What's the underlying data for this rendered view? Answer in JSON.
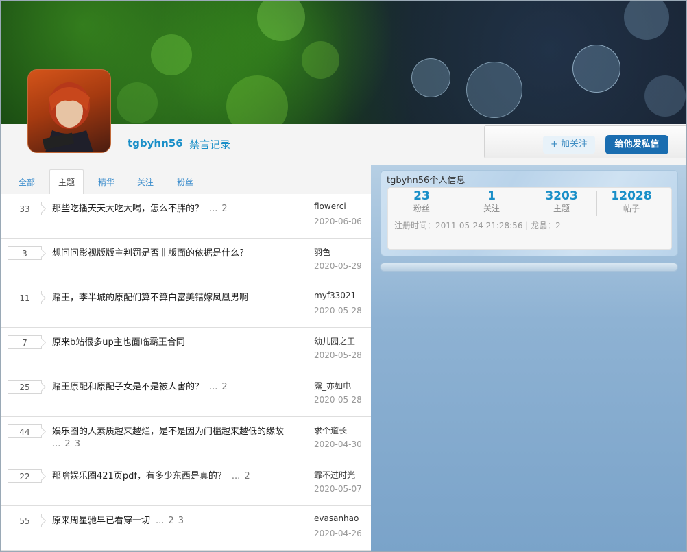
{
  "profile": {
    "username": "tgbyhn56",
    "ban_record": "禁言记录",
    "avatar_icon": "death-note-avatar-icon"
  },
  "actions": {
    "follow": "+ 加关注",
    "message": "给他发私信"
  },
  "tabs": [
    {
      "label": "全部",
      "active": false
    },
    {
      "label": "主题",
      "active": true
    },
    {
      "label": "精华",
      "active": false
    },
    {
      "label": "关注",
      "active": false
    },
    {
      "label": "粉丝",
      "active": false
    }
  ],
  "threads": [
    {
      "count": "33",
      "title": "那些吃播天天大吃大喝，怎么不胖的？",
      "pages": [
        "...",
        "2"
      ],
      "author": "flowerci",
      "date": "2020-06-06"
    },
    {
      "count": "3",
      "title": "想问问影视版版主判罚是否非版面的依据是什么？",
      "pages": [],
      "author": "羽色",
      "date": "2020-05-29"
    },
    {
      "count": "11",
      "title": "赌王，李半城的原配们算不算白富美错嫁凤凰男啊",
      "pages": [],
      "author": "myf33021",
      "date": "2020-05-28"
    },
    {
      "count": "7",
      "title": "原来b站很多up主也面临霸王合同",
      "pages": [],
      "author": "幼儿园之王",
      "date": "2020-05-28"
    },
    {
      "count": "25",
      "title": "赌王原配和原配子女是不是被人害的？",
      "pages": [
        "...",
        "2"
      ],
      "author": "露_亦如电",
      "date": "2020-05-28"
    },
    {
      "count": "44",
      "title": "娱乐圈的人素质越来越烂，是不是因为门槛越来越低的缘故",
      "pages": [
        "...",
        "2",
        "3"
      ],
      "author": "求个道长",
      "date": "2020-04-30"
    },
    {
      "count": "22",
      "title": "那啥娱乐圈421页pdf，有多少东西是真的？",
      "pages": [
        "...",
        "2"
      ],
      "author": "霏不过时光",
      "date": "2020-05-07"
    },
    {
      "count": "55",
      "title": "原来周星驰早已看穿一切",
      "pages": [
        "...",
        "2",
        "3"
      ],
      "author": "evasanhao",
      "date": "2020-04-26"
    }
  ],
  "info": {
    "title": "tgbyhn56个人信息",
    "stats": [
      {
        "num": "23",
        "label": "粉丝"
      },
      {
        "num": "1",
        "label": "关注"
      },
      {
        "num": "3203",
        "label": "主题"
      },
      {
        "num": "12028",
        "label": "帖子"
      }
    ],
    "register": "注册时间：2011-05-24 21:28:56 | 龙晶：2"
  }
}
